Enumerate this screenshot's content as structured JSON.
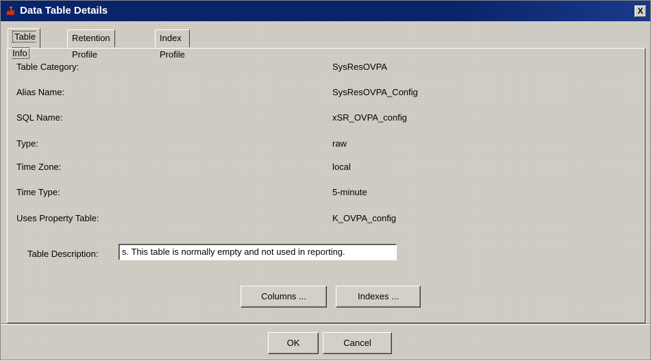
{
  "window": {
    "title": "Data Table Details",
    "close_label": "X"
  },
  "tabs": [
    {
      "label": "Table Info"
    },
    {
      "label": "Retention Profile"
    },
    {
      "label": "Index Profile"
    }
  ],
  "fields": [
    {
      "label": "Table Category:",
      "value": "SysResOVPA"
    },
    {
      "label": "Alias Name:",
      "value": "SysResOVPA_Config"
    },
    {
      "label": "SQL Name:",
      "value": "xSR_OVPA_config"
    },
    {
      "label": "Type:",
      "value": "raw"
    },
    {
      "label": "Time Zone:",
      "value": "local"
    },
    {
      "label": "Time Type:",
      "value": "5-minute"
    },
    {
      "label": "Uses Property Table:",
      "value": "K_OVPA_config"
    }
  ],
  "description": {
    "label": "Table Description:",
    "value": "s. This table is normally empty and not used in reporting."
  },
  "panel_buttons": {
    "columns": "Columns ...",
    "indexes": "Indexes ..."
  },
  "dialog_buttons": {
    "ok": "OK",
    "cancel": "Cancel"
  }
}
